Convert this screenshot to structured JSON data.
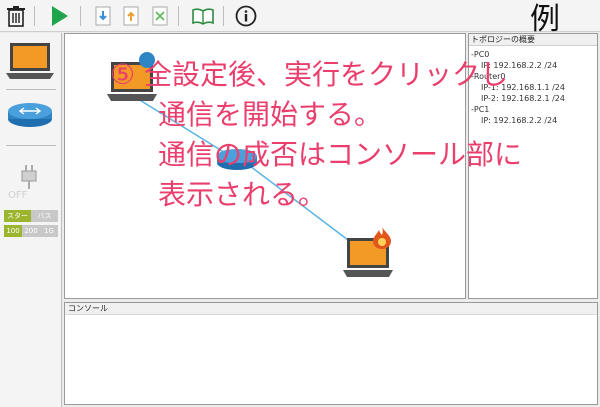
{
  "toolbar": {
    "buttons": [
      "trash-icon",
      "run-icon",
      "import-icon",
      "export-icon",
      "clear-icon",
      "notebook-icon",
      "info-icon"
    ],
    "example_label": "例"
  },
  "left_panel": {
    "off_label": "OFF",
    "mode_labels": [
      "スター",
      "バス"
    ],
    "speed_labels": [
      "100",
      "200",
      "1G"
    ]
  },
  "overview": {
    "title": "トポロジーの概要",
    "tree": [
      {
        "marker": "-",
        "label": "PC0"
      },
      {
        "marker": "",
        "label": "IP: 192.168.2.2 /24"
      },
      {
        "marker": "-",
        "label": "Router0"
      },
      {
        "marker": "",
        "label": "IP-1: 192.168.1.1 /24"
      },
      {
        "marker": "",
        "label": "IP-2: 192.168.2.1 /24"
      },
      {
        "marker": "-",
        "label": "PC1"
      },
      {
        "marker": "",
        "label": "IP: 192.168.2.2 /24"
      }
    ]
  },
  "console": {
    "title": "コンソール"
  },
  "annotation": {
    "line1": "⑤ 全設定後、実行をクリックし",
    "line2": "通信を開始する。",
    "line3": "通信の成否はコンソール部に",
    "line4": "表示される。"
  },
  "colors": {
    "accent": "#ea3f6d",
    "link": "#5ab4e3",
    "laptop": "#f39a26",
    "router": "#2f84c4"
  }
}
